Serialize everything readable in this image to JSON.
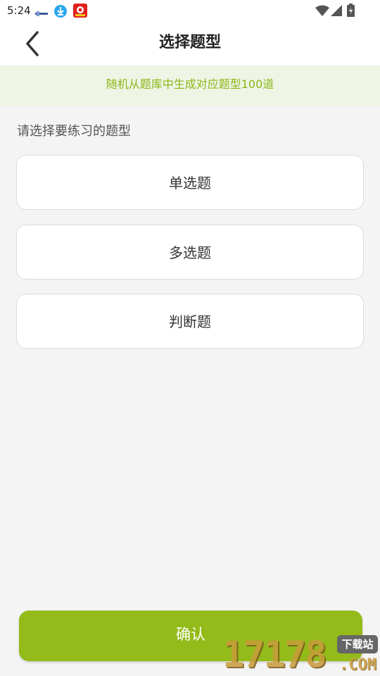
{
  "status_bar": {
    "time": "5:24",
    "notification_icons": [
      "small-app-icon",
      "download-icon",
      "red-app-icon"
    ],
    "system_icons": [
      "wifi-icon",
      "signal-icon",
      "battery-icon"
    ]
  },
  "header": {
    "back_icon": "chevron-left-icon",
    "title": "选择题型"
  },
  "notice": {
    "text": "随机从题库中生成对应题型100道"
  },
  "main": {
    "prompt": "请选择要练习的题型",
    "options": [
      {
        "label": "单选题"
      },
      {
        "label": "多选题"
      },
      {
        "label": "判断题"
      }
    ]
  },
  "footer": {
    "confirm_label": "确认"
  },
  "watermark": {
    "number": "17178",
    "domain": ".COM",
    "badge": "下载站"
  },
  "colors": {
    "accent": "#93bb1a",
    "notice_text": "#8cb617",
    "notice_bg": "#eef5e5",
    "page_bg": "#f4f4f4"
  }
}
